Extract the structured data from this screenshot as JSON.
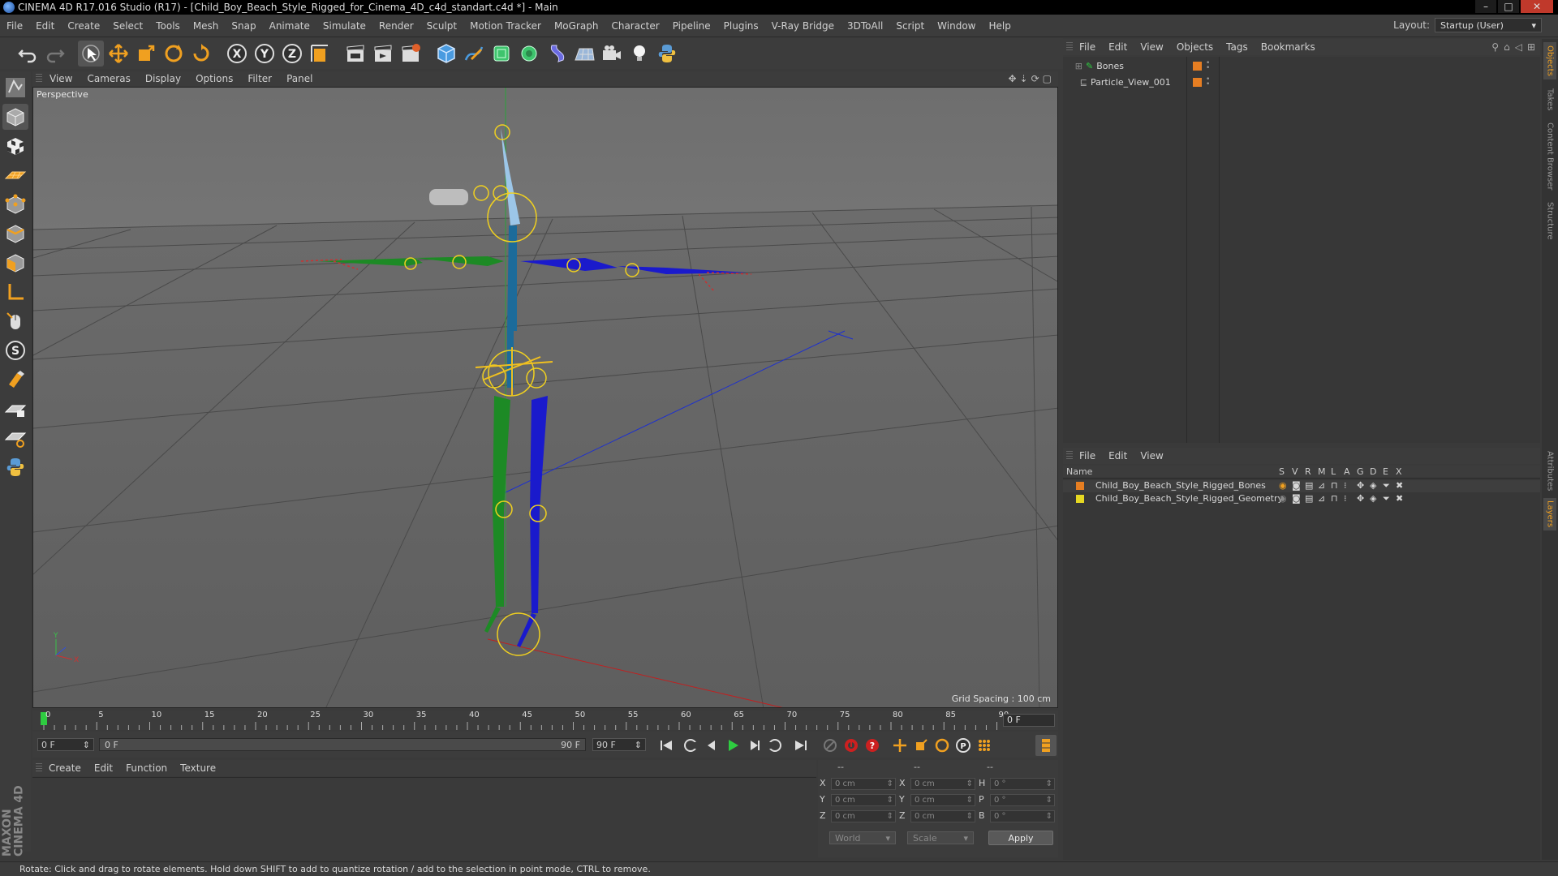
{
  "window": {
    "title": "CINEMA 4D R17.016 Studio (R17) - [Child_Boy_Beach_Style_Rigged_for_Cinema_4D_c4d_standart.c4d *] - Main"
  },
  "menubar": {
    "items": [
      "File",
      "Edit",
      "Create",
      "Select",
      "Tools",
      "Mesh",
      "Snap",
      "Animate",
      "Simulate",
      "Render",
      "Sculpt",
      "Motion Tracker",
      "MoGraph",
      "Character",
      "Pipeline",
      "Plugins",
      "V-Ray Bridge",
      "3DToAll",
      "Script",
      "Window",
      "Help"
    ],
    "layout_label": "Layout:",
    "layout_value": "Startup (User)"
  },
  "viewport": {
    "menu": [
      "View",
      "Cameras",
      "Display",
      "Options",
      "Filter",
      "Panel"
    ],
    "label": "Perspective",
    "grid_spacing": "Grid Spacing : 100 cm"
  },
  "timeline": {
    "ticks": [
      "0",
      "5",
      "10",
      "15",
      "20",
      "25",
      "30",
      "35",
      "40",
      "45",
      "50",
      "55",
      "60",
      "65",
      "70",
      "75",
      "80",
      "85",
      "90"
    ],
    "current_frame": "0 F",
    "start_field": "0 F",
    "slider_start": "0 F",
    "slider_end": "90 F",
    "end_field": "90 F"
  },
  "material_manager": {
    "menu": [
      "Create",
      "Edit",
      "Function",
      "Texture"
    ]
  },
  "coordinates": {
    "header": [
      "--",
      "--",
      "--"
    ],
    "rows": [
      {
        "l1": "X",
        "v1": "0 cm",
        "l2": "X",
        "v2": "0 cm",
        "l3": "H",
        "v3": "0 °"
      },
      {
        "l1": "Y",
        "v1": "0 cm",
        "l2": "Y",
        "v2": "0 cm",
        "l3": "P",
        "v3": "0 °"
      },
      {
        "l1": "Z",
        "v1": "0 cm",
        "l2": "Z",
        "v2": "0 cm",
        "l3": "B",
        "v3": "0 °"
      }
    ],
    "space": "World",
    "mode": "Scale",
    "apply": "Apply"
  },
  "object_manager": {
    "menu": [
      "File",
      "Edit",
      "View",
      "Objects",
      "Tags",
      "Bookmarks"
    ],
    "objects": [
      {
        "name": "Bones",
        "color": "#e67e22"
      },
      {
        "name": "Particle_View_001",
        "color": "#e67e22"
      }
    ]
  },
  "layer_manager": {
    "menu": [
      "File",
      "Edit",
      "View"
    ],
    "columns": {
      "name": "Name",
      "flags": [
        "S",
        "V",
        "R",
        "M",
        "L",
        "A",
        "G",
        "D",
        "E",
        "X"
      ]
    },
    "layers": [
      {
        "name": "Child_Boy_Beach_Style_Rigged_Bones",
        "color": "#e67e22"
      },
      {
        "name": "Child_Boy_Beach_Style_Rigged_Geometry",
        "color": "#e6d822"
      }
    ]
  },
  "right_tabs": [
    "Objects",
    "Takes",
    "Content Browser",
    "Structure",
    "Attributes",
    "Layers"
  ],
  "branding": {
    "logo": "MAXON CINEMA 4D"
  },
  "status": {
    "text": "Rotate: Click and drag to rotate elements. Hold down SHIFT to add to quantize rotation / add to the selection in point mode, CTRL to remove."
  }
}
